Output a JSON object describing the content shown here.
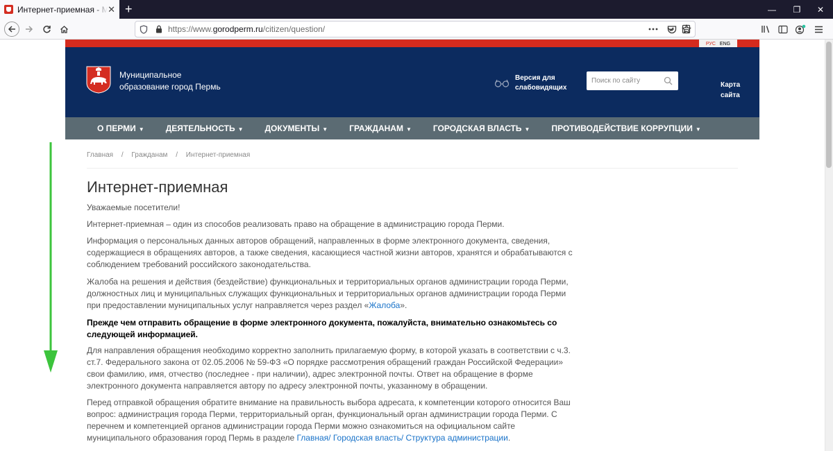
{
  "browser": {
    "tab_title": "Интернет-приемная - Муниц",
    "new_tab": "+",
    "url_prefix": "https://www.",
    "url_domain": "gorodperm.ru",
    "url_path": "/citizen/question/",
    "window_minimize": "—",
    "window_restore": "❐",
    "window_close": "✕"
  },
  "site": {
    "lang_ru": "РУС",
    "lang_en": "ENG",
    "logo_line1": "Муниципальное",
    "logo_line2": "образование город Пермь",
    "vision_line1": "Версия для",
    "vision_line2": "слабовидящих",
    "search_placeholder": "Поиск по сайту",
    "sitemap_line1": "Карта",
    "sitemap_line2": "сайта",
    "nav": [
      {
        "label": "О ПЕРМИ"
      },
      {
        "label": "ДЕЯТЕЛЬНОСТЬ"
      },
      {
        "label": "ДОКУМЕНТЫ"
      },
      {
        "label": "ГРАЖДАНАМ"
      },
      {
        "label": "ГОРОДСКАЯ ВЛАСТЬ"
      },
      {
        "label": "ПРОТИВОДЕЙСТВИЕ КОРРУПЦИИ"
      }
    ]
  },
  "breadcrumb": {
    "home": "Главная",
    "section": "Гражданам",
    "current": "Интернет-приемная",
    "separator": "/"
  },
  "article": {
    "title": "Интернет-приемная",
    "p1": "Уважаемые посетители!",
    "p2": "Интернет-приемная – один из способов реализовать право на обращение в администрацию города Перми.",
    "p3": "Информация о персональных данных авторов обращений, направленных в форме электронного документа, сведения, содержащиеся в обращениях авторов, а также сведения, касающиеся частной жизни авторов, хранятся и обрабатываются с соблюдением требований российского законодательства.",
    "p4_before": "Жалоба на решения и действия (бездействие) функциональных и территориальных органов администрации города Перми, должностных лиц и муниципальных служащих функциональных и территориальных органов администрации города Перми при предоставлении муниципальных услуг направляется через раздел «",
    "p4_link": "Жалоба",
    "p4_after": "».",
    "p5": "Прежде чем отправить обращение в форме электронного документа, пожалуйста, внимательно ознакомьтесь со следующей информацией.",
    "p6": "Для направления обращения необходимо корректно заполнить прилагаемую форму, в которой указать в соответствии с ч.3. ст.7. Федерального закона от 02.05.2006 № 59-ФЗ «О порядке рассмотрения обращений граждан Российской Федерации» свои фамилию, имя, отчество (последнее - при наличии), адрес электронной почты. Ответ на обращение в форме электронного документа направляется автору по адресу электронной почты, указанному в обращении.",
    "p7_before": "Перед отправкой обращения обратите внимание на правильность выбора адресата, к компетенции которого относится Ваш вопрос: администрация города Перми, территориальный орган, функциональный орган администрации города Перми. С перечнем и компетенцией органов администрации города Перми можно ознакомиться на официальном сайте муниципального образования город Пермь в разделе ",
    "p7_link": "Главная/ Городская власть/ Структура администрации",
    "p7_after": "."
  },
  "colors": {
    "header_blue": "#0c2b5f",
    "nav_gray": "#5b6b73",
    "accent_red": "#d52b1e",
    "link_blue": "#1a73c9",
    "arrow_green": "#3cc43c"
  }
}
